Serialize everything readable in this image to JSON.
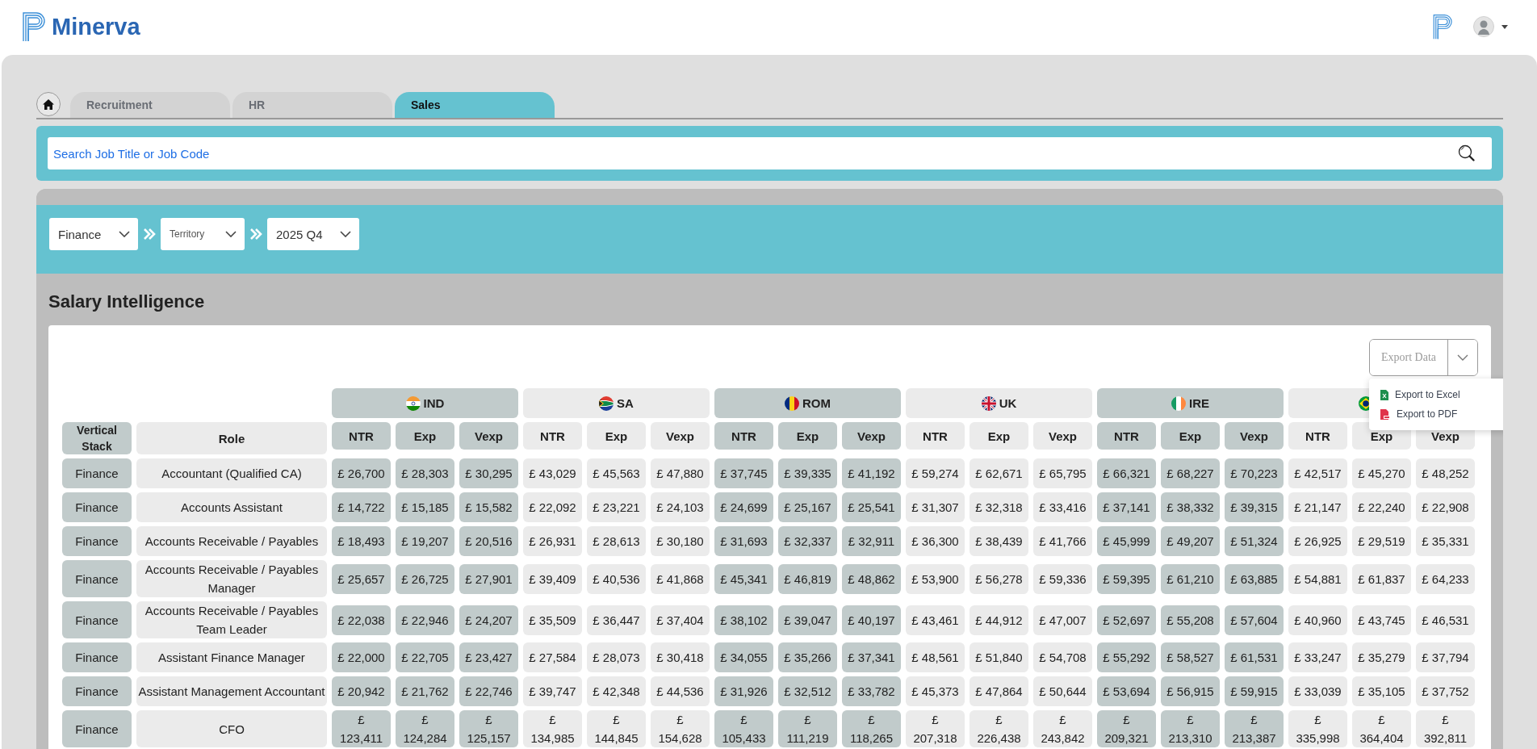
{
  "header": {
    "brand": "Minerva"
  },
  "tabs": [
    {
      "label": "Recruitment",
      "selected": false
    },
    {
      "label": "HR",
      "selected": false
    },
    {
      "label": "Sales",
      "selected": true
    }
  ],
  "search": {
    "placeholder": "Search Job Title or Job Code"
  },
  "filters": [
    {
      "value": "Finance"
    },
    {
      "placeholder": "Territory"
    },
    {
      "value": "2025 Q4"
    }
  ],
  "section_title": "Salary Intelligence",
  "export": {
    "label": "Export Data",
    "menu_open": true,
    "menu": [
      {
        "kind": "excel",
        "label": "Export to Excel"
      },
      {
        "kind": "pdf",
        "label": "Export to PDF"
      }
    ]
  },
  "table": {
    "fixed_columns": [
      "Vertical Stack",
      "Role"
    ],
    "countries": [
      {
        "kind": "named",
        "name": "IND"
      },
      {
        "kind": "named",
        "name": "SA"
      },
      {
        "kind": "named",
        "name": "ROM"
      },
      {
        "kind": "named",
        "name": "UK"
      },
      {
        "kind": "named",
        "name": "IRE"
      },
      {
        "kind": "flag"
      }
    ],
    "subcolumns": [
      "NTR",
      "Exp",
      "Vexp",
      "NTR",
      "Exp",
      "Vexp",
      "NTR",
      "Exp",
      "Vexp",
      "NTR",
      "Exp",
      "Vexp",
      "NTR",
      "Exp",
      "Vexp",
      "NTR",
      "Exp",
      "Vexp"
    ],
    "rows": [
      {
        "stack": "Finance",
        "role": "Accountant (Qualified CA)",
        "values": [
          "£ 26,700",
          "£ 28,303",
          "£ 30,295",
          "£ 43,029",
          "£ 45,563",
          "£ 47,880",
          "£ 37,745",
          "£ 39,335",
          "£ 41,192",
          "£ 59,274",
          "£ 62,671",
          "£ 65,795",
          "£ 66,321",
          "£ 68,227",
          "£ 70,223",
          "£ 42,517",
          "£ 45,270",
          "£ 48,252"
        ]
      },
      {
        "stack": "Finance",
        "role": "Accounts Assistant",
        "values": [
          "£ 14,722",
          "£ 15,185",
          "£ 15,582",
          "£ 22,092",
          "£ 23,221",
          "£ 24,103",
          "£ 24,699",
          "£ 25,167",
          "£ 25,541",
          "£ 31,307",
          "£ 32,318",
          "£ 33,416",
          "£ 37,141",
          "£ 38,332",
          "£ 39,315",
          "£ 21,147",
          "£ 22,240",
          "£ 22,908"
        ]
      },
      {
        "stack": "Finance",
        "role": "Accounts Receivable / Payables",
        "values": [
          "£ 18,493",
          "£ 19,207",
          "£ 20,516",
          "£ 26,931",
          "£ 28,613",
          "£ 30,180",
          "£ 31,693",
          "£ 32,337",
          "£ 32,911",
          "£ 36,300",
          "£ 38,439",
          "£ 41,766",
          "£ 45,999",
          "£ 49,207",
          "£ 51,324",
          "£ 26,925",
          "£ 29,519",
          "£ 35,331"
        ]
      },
      {
        "stack": "Finance",
        "role": "Accounts Receivable / Payables Manager",
        "values": [
          "£ 25,657",
          "£ 26,725",
          "£ 27,901",
          "£ 39,409",
          "£ 40,536",
          "£ 41,868",
          "£ 45,341",
          "£ 46,819",
          "£ 48,862",
          "£ 53,900",
          "£ 56,278",
          "£ 59,336",
          "£ 59,395",
          "£ 61,210",
          "£ 63,885",
          "£ 54,881",
          "£ 61,837",
          "£ 64,233"
        ]
      },
      {
        "stack": "Finance",
        "role": "Accounts Receivable / Payables Team Leader",
        "values": [
          "£ 22,038",
          "£ 22,946",
          "£ 24,207",
          "£ 35,509",
          "£ 36,447",
          "£ 37,404",
          "£ 38,102",
          "£ 39,047",
          "£ 40,197",
          "£ 43,461",
          "£ 44,912",
          "£ 47,007",
          "£ 52,697",
          "£ 55,208",
          "£ 57,604",
          "£ 40,960",
          "£ 43,745",
          "£ 46,531"
        ]
      },
      {
        "stack": "Finance",
        "role": "Assistant Finance Manager",
        "values": [
          "£ 22,000",
          "£ 22,705",
          "£ 23,427",
          "£ 27,584",
          "£ 28,073",
          "£ 30,418",
          "£ 34,055",
          "£ 35,266",
          "£ 37,341",
          "£ 48,561",
          "£ 51,840",
          "£ 54,708",
          "£ 55,292",
          "£ 58,527",
          "£ 61,531",
          "£ 33,247",
          "£ 35,279",
          "£ 37,794"
        ]
      },
      {
        "stack": "Finance",
        "role": "Assistant Management Accountant",
        "values": [
          "£ 20,942",
          "£ 21,762",
          "£ 22,746",
          "£ 39,747",
          "£ 42,348",
          "£ 44,536",
          "£ 31,926",
          "£ 32,512",
          "£ 33,782",
          "£ 45,373",
          "£ 47,864",
          "£ 50,644",
          "£ 53,694",
          "£ 56,915",
          "£ 59,915",
          "£ 33,039",
          "£ 35,105",
          "£ 37,752"
        ]
      },
      {
        "stack": "Finance",
        "role": "CFO",
        "values": [
          "£ 123,411",
          "£ 124,284",
          "£ 125,157",
          "£ 134,985",
          "£ 144,845",
          "£ 154,628",
          "£ 105,433",
          "£ 111,219",
          "£ 118,265",
          "£ 207,318",
          "£ 226,438",
          "£ 243,842",
          "£ 209,321",
          "£ 213,310",
          "£ 213,387",
          "£ 335,998",
          "£ 364,404",
          "£ 392,811"
        ]
      }
    ]
  }
}
